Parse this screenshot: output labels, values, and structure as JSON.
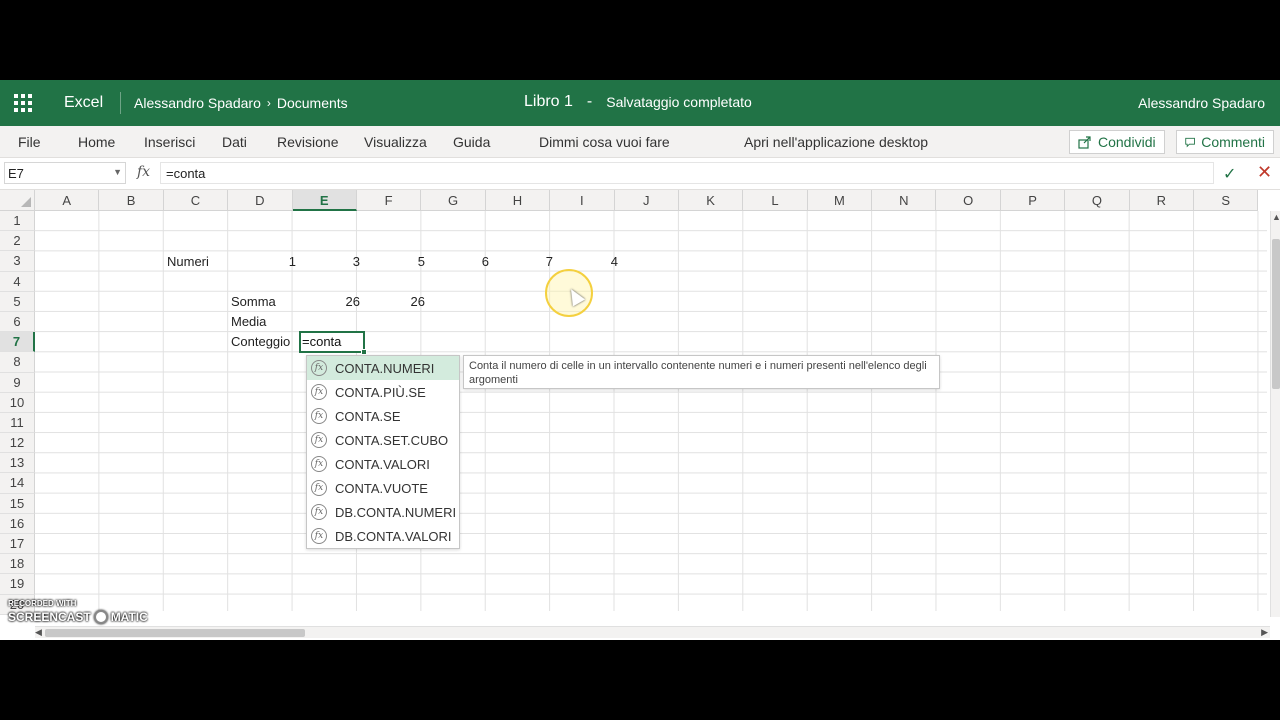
{
  "titlebar": {
    "app_name": "Excel",
    "breadcrumb_owner": "Alessandro Spadaro",
    "breadcrumb_folder": "Documents",
    "doc_title": "Libro 1",
    "doc_separator": "-",
    "doc_status": "Salvataggio completato",
    "user_name": "Alessandro Spadaro"
  },
  "ribbon": {
    "menu": [
      "File",
      "Home",
      "Inserisci",
      "Dati",
      "Revisione",
      "Visualizza",
      "Guida"
    ],
    "tell_me": "Dimmi cosa vuoi fare",
    "open_desktop": "Apri nell'applicazione desktop",
    "share": "Condividi",
    "comments": "Commenti"
  },
  "formula_bar": {
    "name_box": "E7",
    "fx": "fx",
    "formula": "=conta"
  },
  "grid": {
    "columns": [
      "A",
      "B",
      "C",
      "D",
      "E",
      "F",
      "G",
      "H",
      "I",
      "J",
      "K",
      "L",
      "M",
      "N",
      "O",
      "P",
      "Q",
      "R",
      "S"
    ],
    "active_column": "E",
    "rows": [
      "1",
      "2",
      "3",
      "4",
      "5",
      "6",
      "7",
      "8",
      "9",
      "10",
      "11",
      "12",
      "13",
      "14",
      "15",
      "16",
      "17",
      "18",
      "19",
      "20"
    ],
    "active_row": "7",
    "cells": {
      "C3": "Numeri",
      "D3": "1",
      "E3": "3",
      "F3": "5",
      "G3": "6",
      "H3": "7",
      "I3": "4",
      "D5": "Somma",
      "E5": "26",
      "F5": "26",
      "D6": "Media",
      "D7": "Conteggio",
      "E7": "=conta"
    }
  },
  "autocomplete": {
    "items": [
      "CONTA.NUMERI",
      "CONTA.PIÙ.SE",
      "CONTA.SE",
      "CONTA.SET.CUBO",
      "CONTA.VALORI",
      "CONTA.VUOTE",
      "DB.CONTA.NUMERI",
      "DB.CONTA.VALORI"
    ],
    "selected_index": 0,
    "tooltip": "Conta il numero di celle in un intervallo contenente numeri e i numeri presenti nell'elenco degli argomenti"
  },
  "watermark": {
    "line1": "RECORDED WITH",
    "line2a": "SCREENCAST",
    "line2b": "MATIC"
  },
  "colors": {
    "brand": "#217346",
    "selected_item": "#d3ebdd"
  }
}
